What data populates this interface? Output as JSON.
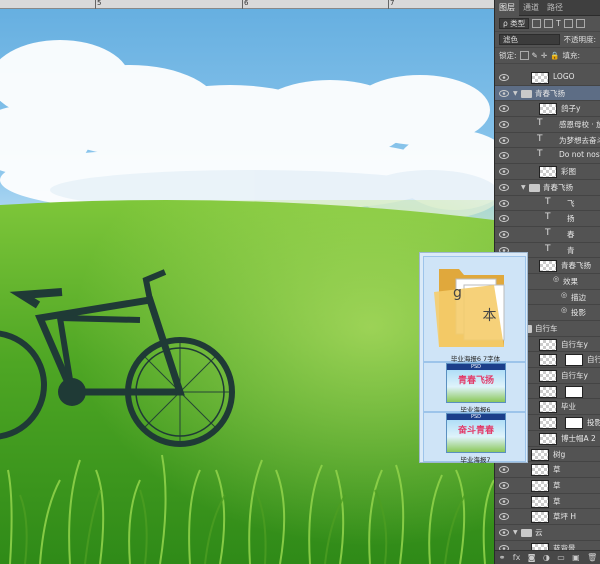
{
  "ruler": {
    "marks": [
      "5",
      "6",
      "7"
    ]
  },
  "panel": {
    "tabs": [
      "图层",
      "通道",
      "路径"
    ],
    "filter_kind": "ρ 类型",
    "blend_mode": "滤色",
    "opacity_label": "不透明度:",
    "lock_label": "锁定:",
    "fill_label": "填充:",
    "layers": [
      {
        "name": "LOGO",
        "kind": "pixel"
      },
      {
        "name": "青春飞扬",
        "kind": "group",
        "selected": true
      },
      {
        "name": "鸽子y",
        "kind": "pixel"
      },
      {
        "name": "感恩母校 · 放飞",
        "kind": "text"
      },
      {
        "name": "为梦想去奋斗",
        "kind": "text"
      },
      {
        "name": "Do not nostalgi",
        "kind": "text"
      },
      {
        "name": "彩图",
        "kind": "pixel"
      },
      {
        "name": "青春飞扬",
        "kind": "group"
      },
      {
        "name": "飞",
        "kind": "text"
      },
      {
        "name": "扬",
        "kind": "text"
      },
      {
        "name": "春",
        "kind": "text"
      },
      {
        "name": "青",
        "kind": "text"
      },
      {
        "name": "青春飞扬",
        "kind": "pixel"
      },
      {
        "name": "效果",
        "kind": "effect"
      },
      {
        "name": "描边",
        "kind": "effect"
      },
      {
        "name": "投影",
        "kind": "effect"
      },
      {
        "name": "自行车",
        "kind": "group"
      },
      {
        "name": "自行车y",
        "kind": "pixel"
      },
      {
        "name": "自行车",
        "kind": "mask"
      },
      {
        "name": "自行车y",
        "kind": "pixel"
      },
      {
        "name": "",
        "kind": "mask"
      },
      {
        "name": "毕业",
        "kind": "pixel"
      },
      {
        "name": "投影",
        "kind": "mask"
      },
      {
        "name": "博士帽A 2",
        "kind": "pixel"
      },
      {
        "name": "树g",
        "kind": "pixel"
      },
      {
        "name": "草",
        "kind": "pixel"
      },
      {
        "name": "草",
        "kind": "pixel"
      },
      {
        "name": "草",
        "kind": "pixel"
      },
      {
        "name": "草坪 H",
        "kind": "pixel"
      },
      {
        "name": "云",
        "kind": "group"
      },
      {
        "name": "蓝背景",
        "kind": "pixel"
      }
    ],
    "bottom_icons": [
      "link-icon",
      "fx-icon",
      "mask-icon",
      "adjustment-icon",
      "folder-icon",
      "new-layer-icon",
      "trash-icon"
    ]
  },
  "popup": {
    "items": [
      {
        "caption": "毕业海报6 7字体",
        "type": "folder",
        "letters": [
          "g",
          "本"
        ]
      },
      {
        "caption": "毕业海报6",
        "type": "poster",
        "badge": "PSD",
        "title": "青春飞扬"
      },
      {
        "caption": "毕业海报7",
        "type": "poster",
        "badge": "PSD",
        "title": "奋斗青春"
      }
    ]
  }
}
